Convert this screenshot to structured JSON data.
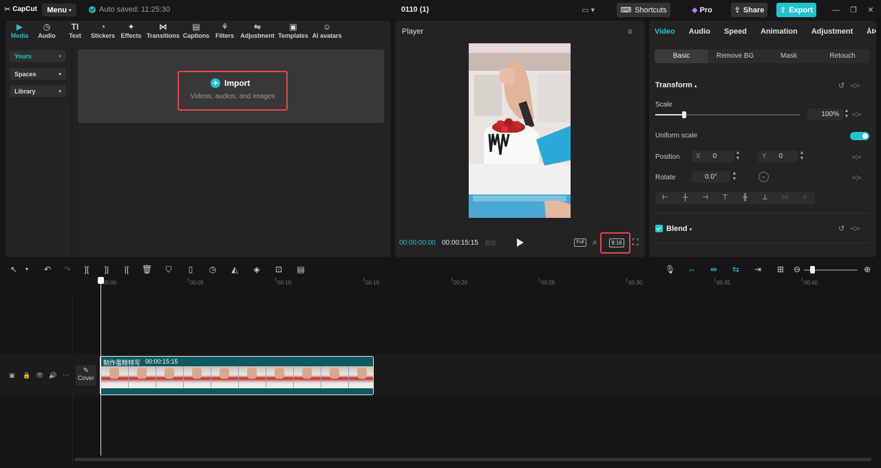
{
  "app": {
    "logo": "CapCut",
    "menu_label": "Menu",
    "autosave": "Auto saved: 11:25:30",
    "project_title": "0110 (1)"
  },
  "topbar": {
    "shortcuts_label": "Shortcuts",
    "pro_label": "Pro",
    "share_label": "Share",
    "export_label": "Export",
    "accent": "#1fc4cf"
  },
  "media_tabs": [
    {
      "label": "Media",
      "icon": "media-icon"
    },
    {
      "label": "Audio",
      "icon": "audio-icon"
    },
    {
      "label": "Text",
      "icon": "text-icon"
    },
    {
      "label": "Stickers",
      "icon": "stickers-icon"
    },
    {
      "label": "Effects",
      "icon": "effects-icon"
    },
    {
      "label": "Transitions",
      "icon": "transitions-icon"
    },
    {
      "label": "Captions",
      "icon": "captions-icon"
    },
    {
      "label": "Filters",
      "icon": "filters-icon"
    },
    {
      "label": "Adjustment",
      "icon": "adjustment-icon"
    },
    {
      "label": "Templates",
      "icon": "templates-icon"
    },
    {
      "label": "AI avatars",
      "icon": "ai-avatars-icon"
    }
  ],
  "sidebar": {
    "items": [
      {
        "label": "Yours"
      },
      {
        "label": "Spaces"
      },
      {
        "label": "Library"
      }
    ]
  },
  "import": {
    "label": "Import",
    "sub": "Videos, audios, and images"
  },
  "player": {
    "title": "Player",
    "current_time": "00:00:00:00",
    "total_time": "00:00:15:15",
    "full_label": "Full",
    "ratio_label": "9:16"
  },
  "inspector": {
    "tabs": [
      "Video",
      "Audio",
      "Speed",
      "Animation",
      "Adjustment"
    ],
    "subtabs": [
      "Basic",
      "Remove BG",
      "Mask",
      "Retouch"
    ],
    "transform_title": "Transform",
    "scale_label": "Scale",
    "scale_value": "100%",
    "scale_level": 0.2,
    "uniform_scale_label": "Uniform scale",
    "position_label": "Position",
    "pos_x_label": "X",
    "pos_x_value": "0",
    "pos_y_label": "Y",
    "pos_y_value": "0",
    "rotate_label": "Rotate",
    "rotate_value": "0.0°",
    "blend_title": "Blend"
  },
  "timeline": {
    "ruler": [
      "00:00",
      "00:05",
      "00:10",
      "00:15",
      "00:20",
      "00:25",
      "00:30",
      "00:35",
      "00:40"
    ],
    "cover_label": "Cover",
    "clip_name": "制作蛋糕特写",
    "clip_duration": "00:00:15:15"
  }
}
